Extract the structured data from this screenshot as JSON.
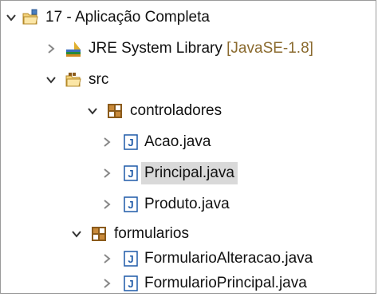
{
  "project": {
    "label": "17 - Aplicação Completa"
  },
  "jre": {
    "label": "JRE System Library",
    "suffix": "[JavaSE-1.8]"
  },
  "src": {
    "label": "src"
  },
  "packages": [
    {
      "label": "controladores",
      "files": [
        "Acao.java",
        "Principal.java",
        "Produto.java"
      ]
    },
    {
      "label": "formularios",
      "files": [
        "FormularioAlteracao.java",
        "FormularioPrincipal.java"
      ]
    }
  ],
  "selected_file": "Principal.java",
  "colors": {
    "selection": "#d9d9d9",
    "suffix": "#8a6a2e",
    "java_icon": "#1f5aa8",
    "package_icon": "#8a5a1a"
  }
}
